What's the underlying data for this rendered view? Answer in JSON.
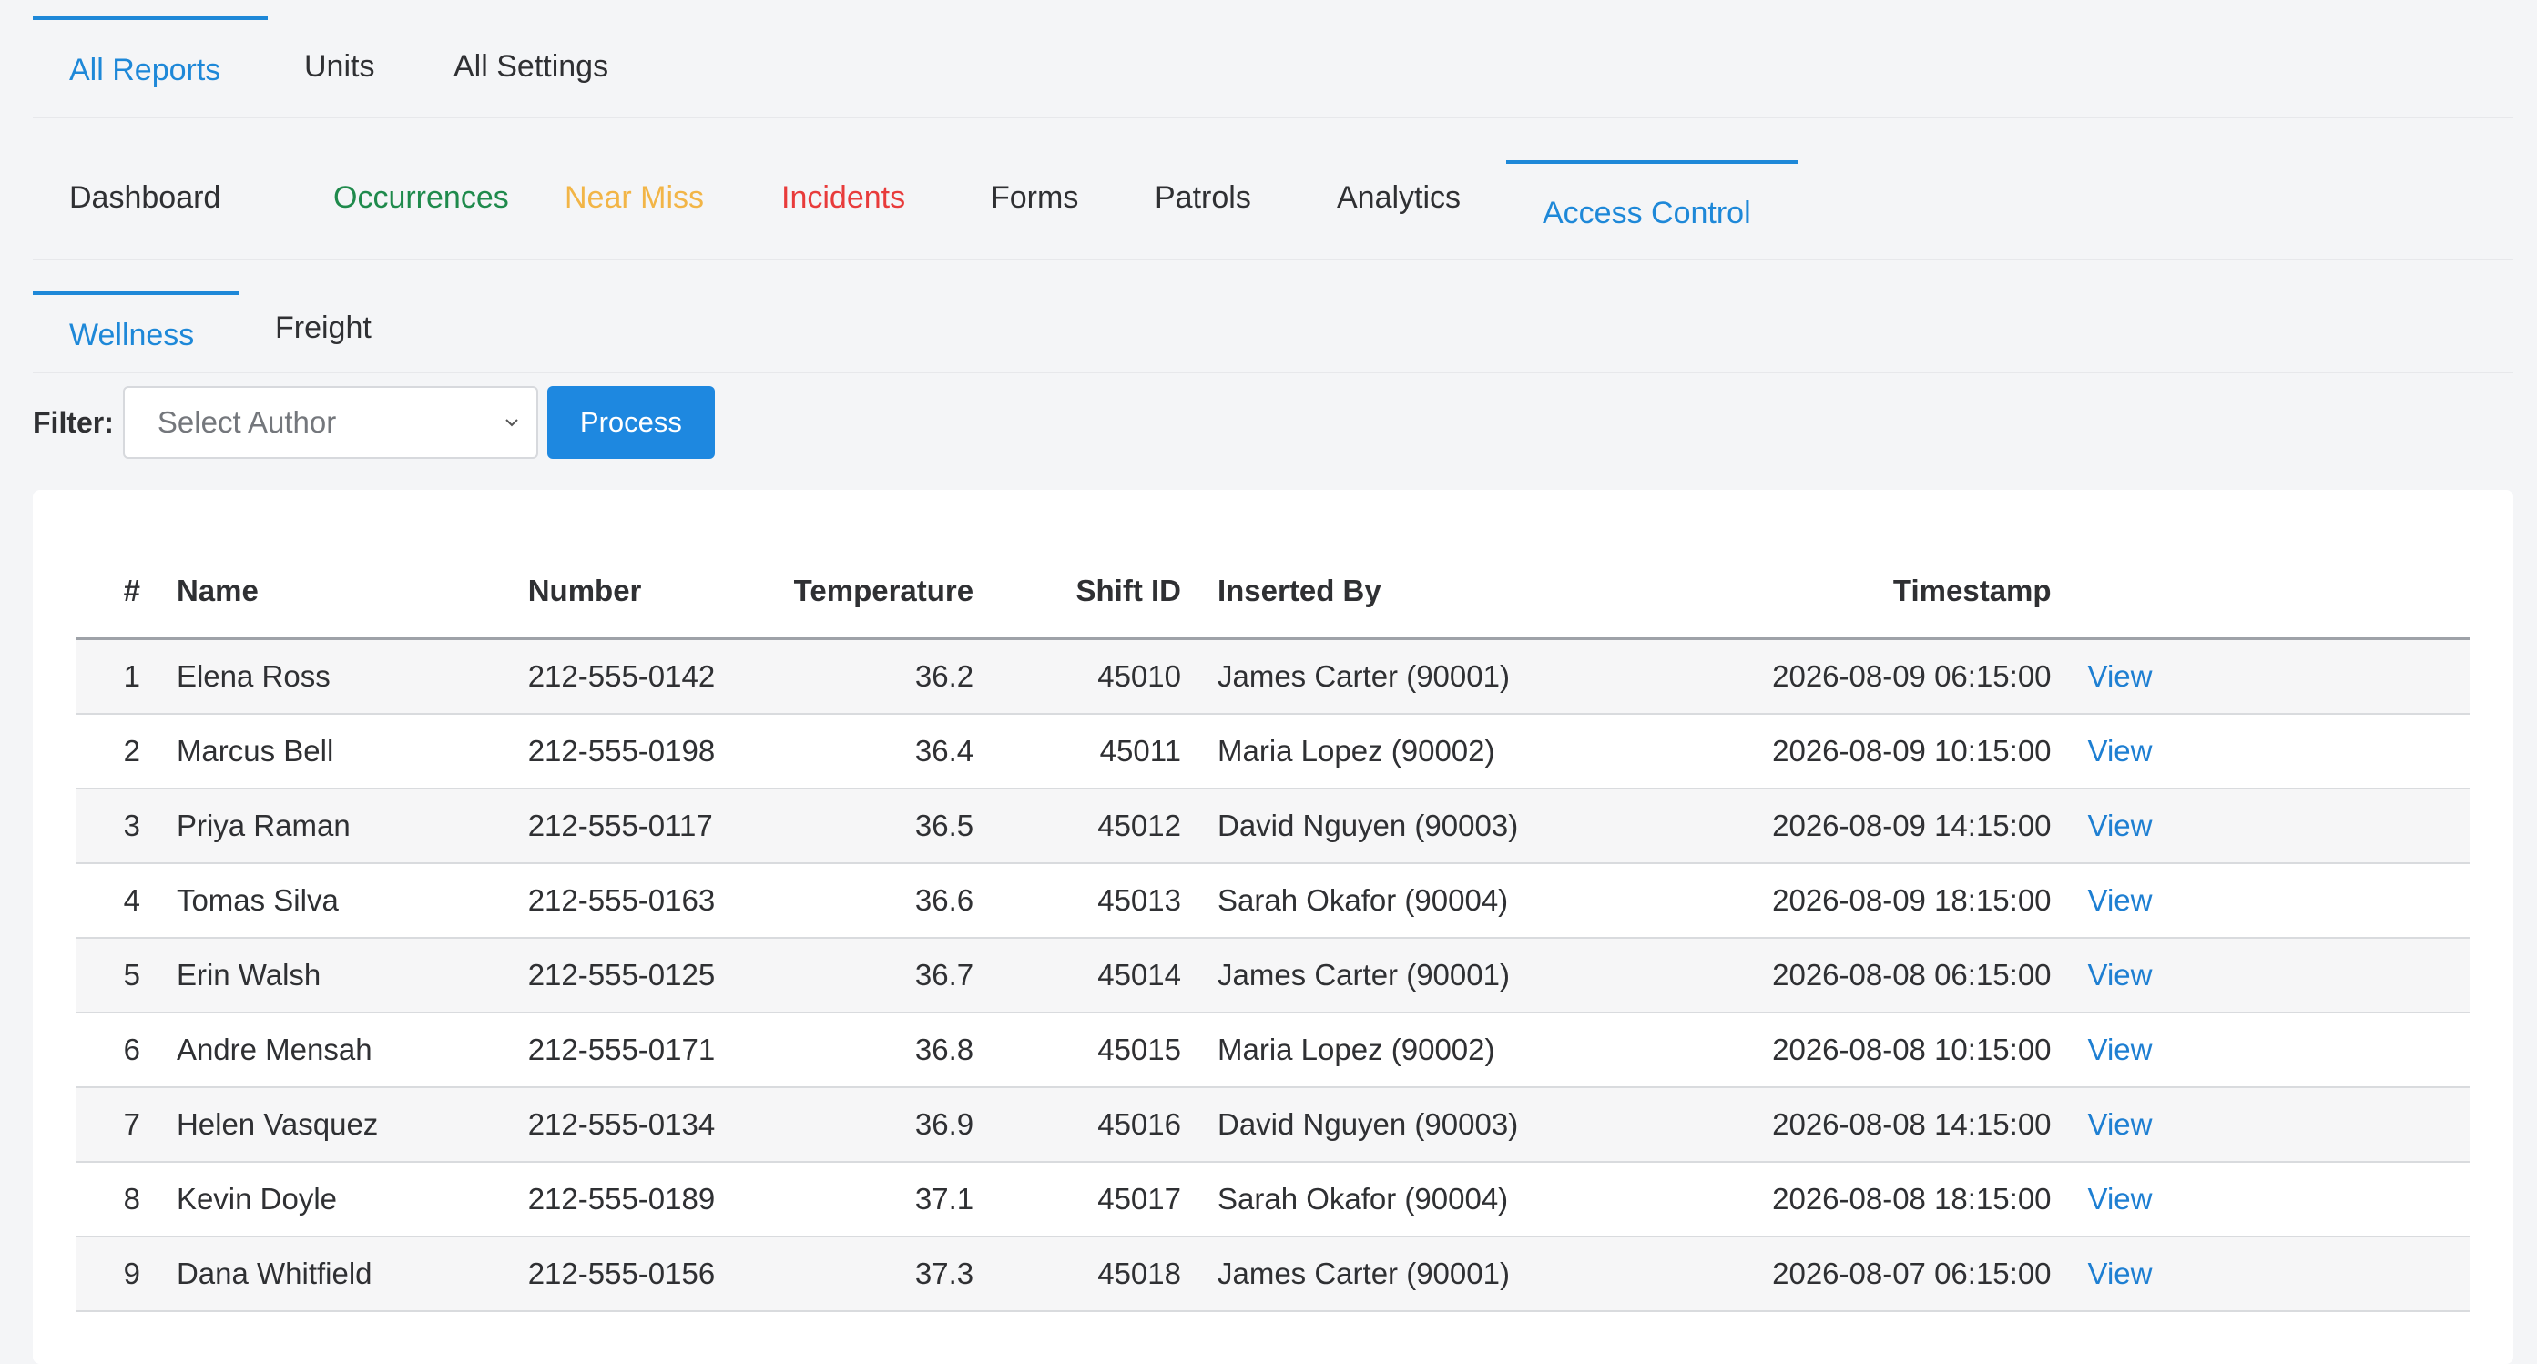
{
  "top_tabs": [
    {
      "label": "All Reports",
      "active": true
    },
    {
      "label": "Units",
      "active": false
    },
    {
      "label": "All Settings",
      "active": false
    }
  ],
  "report_tabs": [
    {
      "label": "Dashboard",
      "color": "#2f3033",
      "active": false
    },
    {
      "label": "Occurrences",
      "color": "#1f8a4c",
      "active": false
    },
    {
      "label": "Near Miss",
      "color": "#f2b547",
      "active": false
    },
    {
      "label": "Incidents",
      "color": "#e83b3b",
      "active": false
    },
    {
      "label": "Forms",
      "color": "#2f3033",
      "active": false
    },
    {
      "label": "Patrols",
      "color": "#2f3033",
      "active": false
    },
    {
      "label": "Analytics",
      "color": "#2f3033",
      "active": false
    },
    {
      "label": "Access Control",
      "color": "#1e88d8",
      "active": true
    }
  ],
  "sub_tabs": [
    {
      "label": "Wellness",
      "active": true
    },
    {
      "label": "Freight",
      "active": false
    }
  ],
  "filter": {
    "label": "Filter:",
    "author_select": "Select Author",
    "process_button": "Process"
  },
  "table": {
    "headers": {
      "index": "#",
      "name": "Name",
      "number": "Number",
      "temperature": "Temperature",
      "shift_id": "Shift ID",
      "inserted_by": "Inserted By",
      "timestamp": "Timestamp"
    },
    "rows": [
      {
        "index": "1",
        "name": "Elena Ross",
        "number": "212-555-0142",
        "temperature": "36.2",
        "shift_id": "45010",
        "inserted_by": "James Carter (90001)",
        "timestamp": "2026-08-09 06:15:00",
        "action": "View"
      },
      {
        "index": "2",
        "name": "Marcus Bell",
        "number": "212-555-0198",
        "temperature": "36.4",
        "shift_id": "45011",
        "inserted_by": "Maria Lopez (90002)",
        "timestamp": "2026-08-09 10:15:00",
        "action": "View"
      },
      {
        "index": "3",
        "name": "Priya Raman",
        "number": "212-555-0117",
        "temperature": "36.5",
        "shift_id": "45012",
        "inserted_by": "David Nguyen (90003)",
        "timestamp": "2026-08-09 14:15:00",
        "action": "View"
      },
      {
        "index": "4",
        "name": "Tomas Silva",
        "number": "212-555-0163",
        "temperature": "36.6",
        "shift_id": "45013",
        "inserted_by": "Sarah Okafor (90004)",
        "timestamp": "2026-08-09 18:15:00",
        "action": "View"
      },
      {
        "index": "5",
        "name": "Erin Walsh",
        "number": "212-555-0125",
        "temperature": "36.7",
        "shift_id": "45014",
        "inserted_by": "James Carter (90001)",
        "timestamp": "2026-08-08 06:15:00",
        "action": "View"
      },
      {
        "index": "6",
        "name": "Andre Mensah",
        "number": "212-555-0171",
        "temperature": "36.8",
        "shift_id": "45015",
        "inserted_by": "Maria Lopez (90002)",
        "timestamp": "2026-08-08 10:15:00",
        "action": "View"
      },
      {
        "index": "7",
        "name": "Helen Vasquez",
        "number": "212-555-0134",
        "temperature": "36.9",
        "shift_id": "45016",
        "inserted_by": "David Nguyen (90003)",
        "timestamp": "2026-08-08 14:15:00",
        "action": "View"
      },
      {
        "index": "8",
        "name": "Kevin Doyle",
        "number": "212-555-0189",
        "temperature": "37.1",
        "shift_id": "45017",
        "inserted_by": "Sarah Okafor (90004)",
        "timestamp": "2026-08-08 18:15:00",
        "action": "View"
      },
      {
        "index": "9",
        "name": "Dana Whitfield",
        "number": "212-555-0156",
        "temperature": "37.3",
        "shift_id": "45018",
        "inserted_by": "James Carter (90001)",
        "timestamp": "2026-08-07 06:15:00",
        "action": "View"
      }
    ]
  }
}
